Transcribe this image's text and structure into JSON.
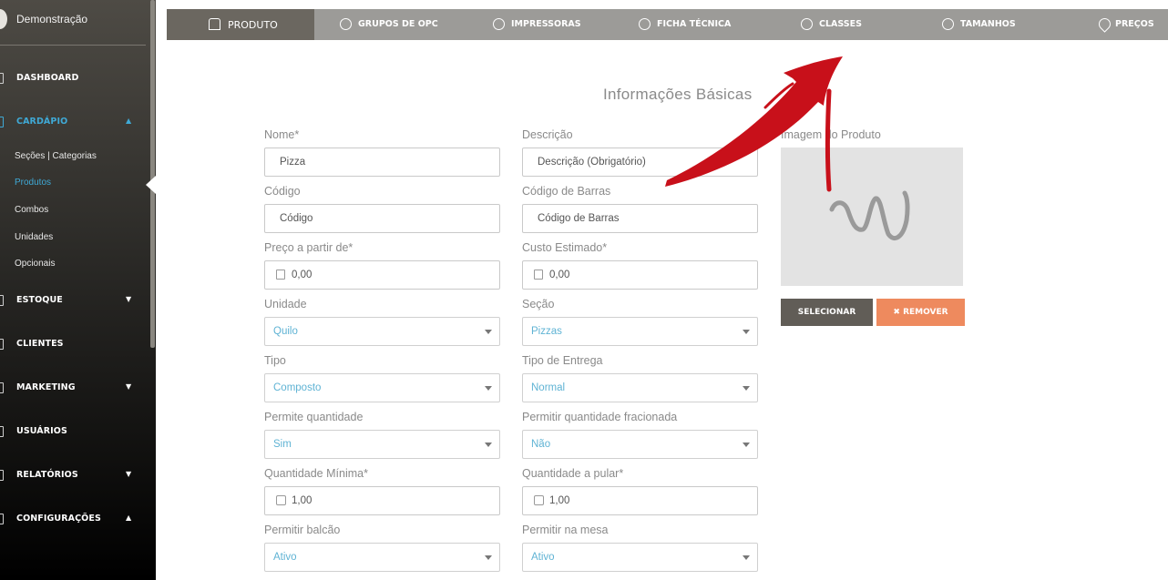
{
  "sidebar": {
    "account_name": "Demonstração",
    "items": [
      {
        "label": "DASHBOARD",
        "caret": ""
      },
      {
        "label": "CARDÁPIO",
        "caret": "▲"
      },
      {
        "label": "ESTOQUE",
        "caret": "▼"
      },
      {
        "label": "CLIENTES",
        "caret": ""
      },
      {
        "label": "MARKETING",
        "caret": "▼"
      },
      {
        "label": "USUÁRIOS",
        "caret": ""
      },
      {
        "label": "RELATÓRIOS",
        "caret": "▼"
      },
      {
        "label": "CONFIGURAÇÕES",
        "caret": "▲"
      }
    ],
    "subitems": [
      "Seções | Categorias",
      "Produtos",
      "Combos",
      "Unidades",
      "Opcionais"
    ]
  },
  "tabs": [
    "PRODUTO",
    "GRUPOS DE OPC",
    "IMPRESSORAS",
    "FICHA TÉCNICA",
    "CLASSES",
    "TAMANHOS",
    "PREÇOS"
  ],
  "form": {
    "title": "Informações Básicas",
    "nome": {
      "label": "Nome*",
      "value": "Pizza"
    },
    "descricao": {
      "label": "Descrição",
      "placeholder": "Descrição (Obrigatório)"
    },
    "codigo": {
      "label": "Código",
      "placeholder": "Código"
    },
    "codigo_barras": {
      "label": "Código de Barras",
      "placeholder": "Código de Barras"
    },
    "preco": {
      "label": "Preço a partir de*",
      "value": "0,00"
    },
    "custo": {
      "label": "Custo Estimado*",
      "value": "0,00"
    },
    "unidade": {
      "label": "Unidade",
      "value": "Quilo"
    },
    "secao": {
      "label": "Seção",
      "value": "Pizzas"
    },
    "tipo": {
      "label": "Tipo",
      "value": "Composto"
    },
    "tipo_entrega": {
      "label": "Tipo de Entrega",
      "value": "Normal"
    },
    "permite_qtd": {
      "label": "Permite quantidade",
      "value": "Sim"
    },
    "permite_qtd_frac": {
      "label": "Permitir quantidade fracionada",
      "value": "Não"
    },
    "qtd_min": {
      "label": "Quantidade Mínima*",
      "value": "1,00"
    },
    "qtd_pular": {
      "label": "Quantidade a pular*",
      "value": "1,00"
    },
    "balcao": {
      "label": "Permitir balcão",
      "value": "Ativo"
    },
    "mesa": {
      "label": "Permitir na mesa",
      "value": "Ativo"
    }
  },
  "image": {
    "label": "Imagem do Produto",
    "select_label": "SELECIONAR",
    "remove_label": "✖ REMOVER"
  },
  "colors": {
    "accent": "#3fa9d6",
    "remove": "#ee8a5e",
    "select": "#615d57",
    "annotation": "#c8101a"
  }
}
